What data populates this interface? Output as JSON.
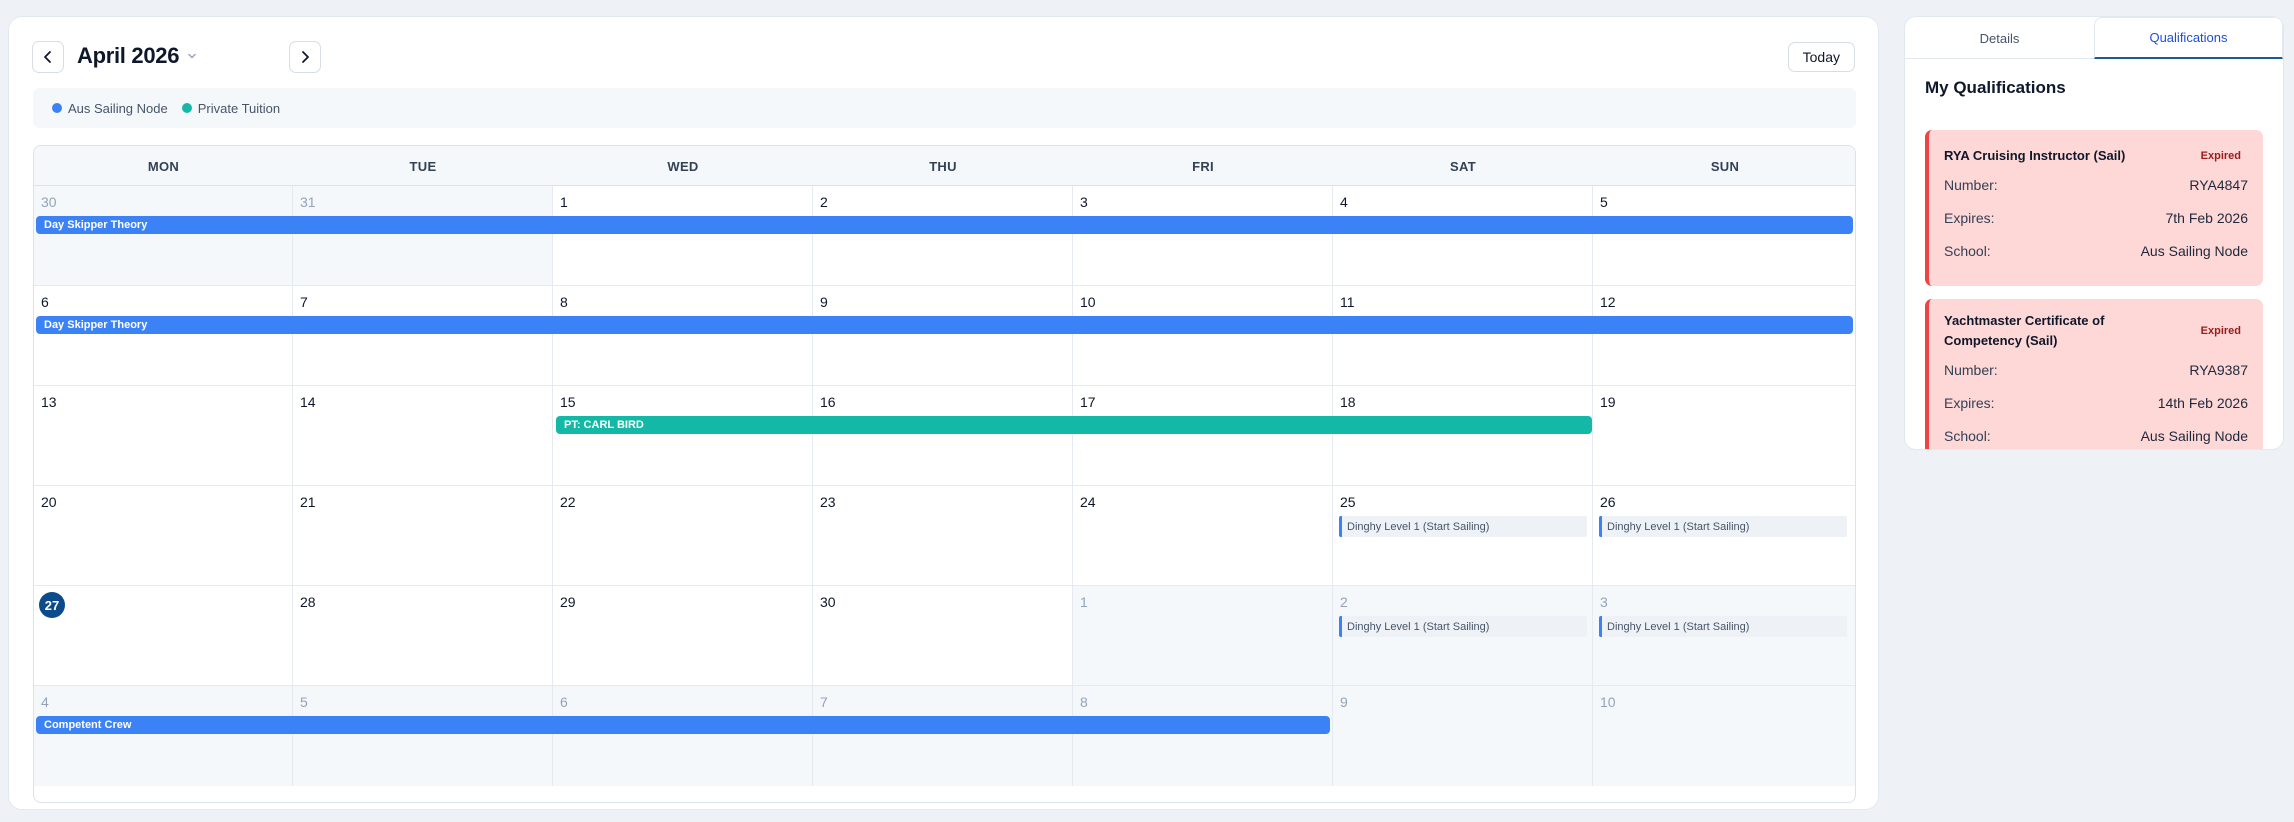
{
  "calendar": {
    "month_title": "April 2026",
    "today_label": "Today",
    "legend": [
      {
        "label": "Aus Sailing Node",
        "color": "#3b82f6"
      },
      {
        "label": "Private Tuition",
        "color": "#14b8a6"
      }
    ],
    "weekdays": [
      "MON",
      "TUE",
      "WED",
      "THU",
      "FRI",
      "SAT",
      "SUN"
    ],
    "weeks": [
      [
        "30",
        "31",
        "1",
        "2",
        "3",
        "4",
        "5"
      ],
      [
        "6",
        "7",
        "8",
        "9",
        "10",
        "11",
        "12"
      ],
      [
        "13",
        "14",
        "15",
        "16",
        "17",
        "18",
        "19"
      ],
      [
        "20",
        "21",
        "22",
        "23",
        "24",
        "25",
        "26"
      ],
      [
        "27",
        "28",
        "29",
        "30",
        "1",
        "2",
        "3"
      ],
      [
        "4",
        "5",
        "6",
        "7",
        "8",
        "9",
        "10"
      ]
    ],
    "events": {
      "week1_bar": "Day Skipper Theory",
      "week2_bar": "Day Skipper Theory",
      "week3_bar": "PT: CARL BIRD",
      "week4_sat": "Dinghy Level 1 (Start Sailing)",
      "week4_sun": "Dinghy Level 1 (Start Sailing)",
      "week5_sat": "Dinghy Level 1 (Start Sailing)",
      "week5_sun": "Dinghy Level 1 (Start Sailing)",
      "week6_bar": "Competent Crew"
    }
  },
  "side_panel": {
    "tabs": [
      "Details",
      "Qualifications"
    ],
    "active_tab": "Qualifications",
    "title": "My Qualifications",
    "qualifications": [
      {
        "name": "RYA Cruising Instructor (Sail)",
        "status": "Expired",
        "number_label": "Number:",
        "number": "RYA4847",
        "expires_label": "Expires:",
        "expires": "7th Feb 2026",
        "school_label": "School:",
        "school": "Aus Sailing Node"
      },
      {
        "name_line1": "Yachtmaster Certificate of",
        "name_line2": "Competency (Sail)",
        "status": "Expired",
        "number_label": "Number:",
        "number": "RYA9387",
        "expires_label": "Expires:",
        "expires": "14th Feb 2026",
        "school_label": "School:",
        "school": "Aus Sailing Node"
      }
    ]
  }
}
